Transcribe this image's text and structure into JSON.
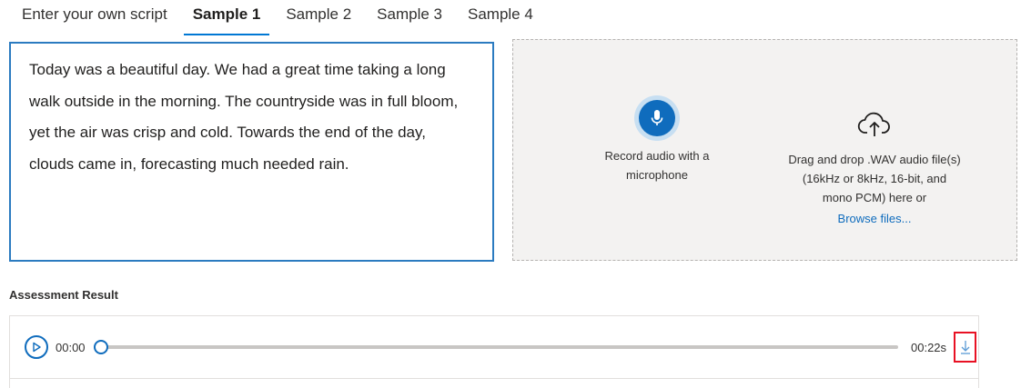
{
  "tabs": [
    {
      "label": "Enter your own script",
      "active": false
    },
    {
      "label": "Sample 1",
      "active": true
    },
    {
      "label": "Sample 2",
      "active": false
    },
    {
      "label": "Sample 3",
      "active": false
    },
    {
      "label": "Sample 4",
      "active": false
    }
  ],
  "script_text": "Today was a beautiful day. We had a great time taking a long walk outside in the morning. The countryside was in full bloom, yet the air was crisp and cold. Towards the end of the day, clouds came in, forecasting much needed rain.",
  "input_panel": {
    "record_label": "Record audio with a microphone",
    "drop_label": "Drag and drop .WAV audio file(s) (16kHz or 8kHz, 16-bit, and mono PCM) here or",
    "browse_label": "Browse files..."
  },
  "result": {
    "heading": "Assessment Result",
    "time_current": "00:00",
    "time_total": "00:22s",
    "progress": 0
  },
  "colors": {
    "accent": "#0f6cbd",
    "highlight_box": "#e81123",
    "panel_bg": "#f3f2f1"
  },
  "icons": [
    "microphone-icon",
    "cloud-upload-icon",
    "play-icon",
    "download-icon"
  ]
}
